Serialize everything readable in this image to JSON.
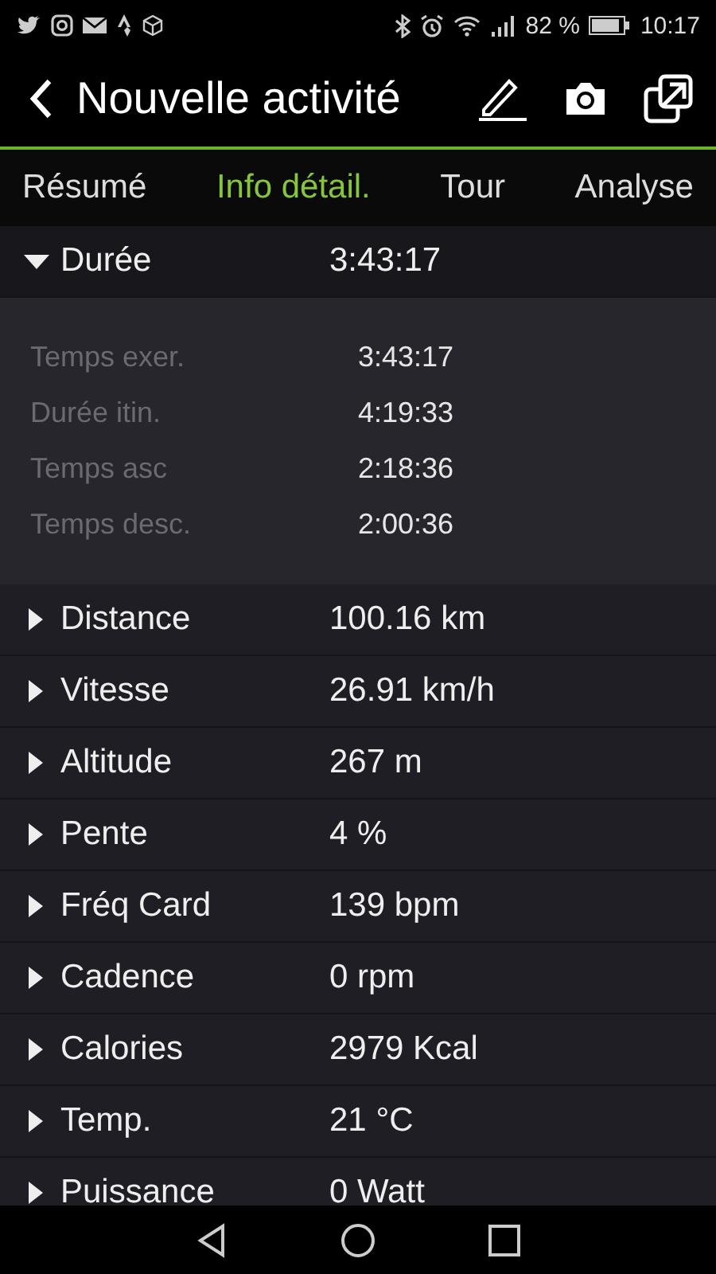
{
  "status_bar": {
    "battery": "82 %",
    "time": "10:17"
  },
  "header": {
    "title": "Nouvelle activité"
  },
  "tabs": [
    {
      "label": "Résumé",
      "selected": false
    },
    {
      "label": "Info détail.",
      "selected": true
    },
    {
      "label": "Tour",
      "selected": false
    },
    {
      "label": "Analyse",
      "selected": false
    }
  ],
  "rows": [
    {
      "label": "Durée",
      "value": "3:43:17",
      "expanded": true,
      "children": [
        {
          "label": "Temps exer.",
          "value": "3:43:17"
        },
        {
          "label": "Durée itin.",
          "value": "4:19:33"
        },
        {
          "label": "Temps asc",
          "value": "2:18:36"
        },
        {
          "label": "Temps desc.",
          "value": "2:00:36"
        }
      ]
    },
    {
      "label": "Distance",
      "value": "100.16 km",
      "expanded": false
    },
    {
      "label": "Vitesse",
      "value": "26.91 km/h",
      "expanded": false
    },
    {
      "label": "Altitude",
      "value": "267 m",
      "expanded": false
    },
    {
      "label": "Pente",
      "value": "4 %",
      "expanded": false
    },
    {
      "label": "Fréq Card",
      "value": "139 bpm",
      "expanded": false
    },
    {
      "label": "Cadence",
      "value": "0 rpm",
      "expanded": false
    },
    {
      "label": "Calories",
      "value": "2979 Kcal",
      "expanded": false
    },
    {
      "label": "Temp.",
      "value": "21 °C",
      "expanded": false
    },
    {
      "label": "Puissance",
      "value": "0 Watt",
      "expanded": false
    }
  ]
}
